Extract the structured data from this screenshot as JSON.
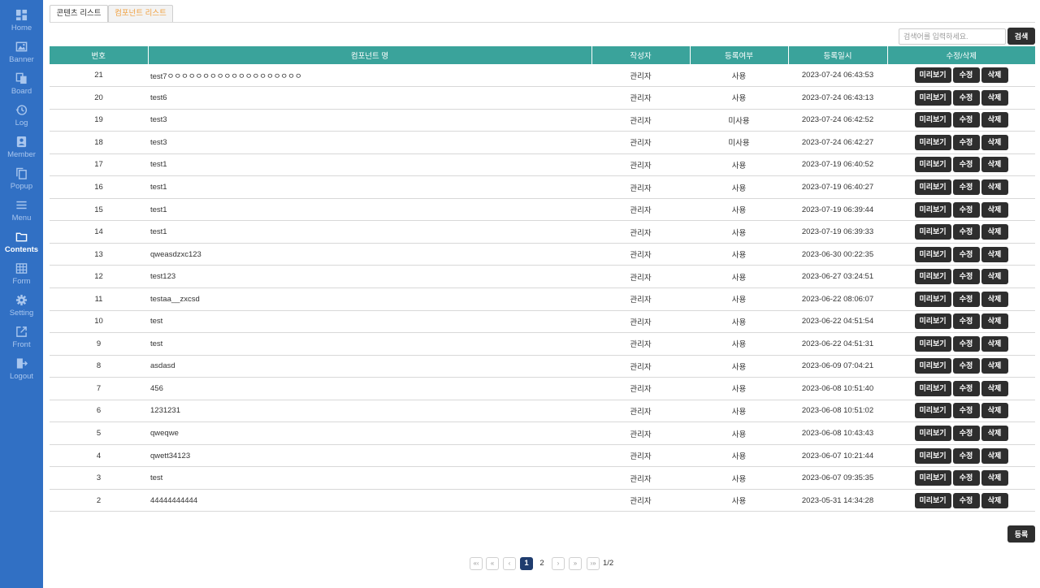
{
  "sidebar": {
    "items": [
      {
        "label": "Home",
        "icon": "dashboard-icon"
      },
      {
        "label": "Banner",
        "icon": "image-icon"
      },
      {
        "label": "Board",
        "icon": "board-icon"
      },
      {
        "label": "Log",
        "icon": "history-icon"
      },
      {
        "label": "Member",
        "icon": "member-badge-icon"
      },
      {
        "label": "Popup",
        "icon": "copy-icon"
      },
      {
        "label": "Menu",
        "icon": "list-icon"
      },
      {
        "label": "Contents",
        "icon": "folder-icon"
      },
      {
        "label": "Form",
        "icon": "table-icon"
      },
      {
        "label": "Setting",
        "icon": "gear-icon"
      },
      {
        "label": "Front",
        "icon": "external-link-icon"
      },
      {
        "label": "Logout",
        "icon": "logout-icon"
      }
    ],
    "active": "Contents"
  },
  "tabs": [
    {
      "label": "콘텐츠 리스트"
    },
    {
      "label": "컴포넌트 리스트"
    }
  ],
  "active_tab": "컴포넌트 리스트",
  "search": {
    "placeholder": "검색어를 입력하세요.",
    "value": "",
    "button": "검색"
  },
  "table": {
    "columns": [
      "번호",
      "컴포넌트 명",
      "작성자",
      "등록여부",
      "등록일시",
      "수정/삭제"
    ],
    "actions": {
      "preview": "미리보기",
      "edit": "수정",
      "delete": "삭제"
    },
    "rows": [
      {
        "no": "21",
        "name": "test7ㅇㅇㅇㅇㅇㅇㅇㅇㅇㅇㅇㅇㅇㅇㅇㅇㅇㅇㅇ",
        "author": "관리자",
        "status": "사용",
        "date": "2023-07-24 06:43:53"
      },
      {
        "no": "20",
        "name": "test6",
        "author": "관리자",
        "status": "사용",
        "date": "2023-07-24 06:43:13"
      },
      {
        "no": "19",
        "name": "test3",
        "author": "관리자",
        "status": "미사용",
        "date": "2023-07-24 06:42:52"
      },
      {
        "no": "18",
        "name": "test3",
        "author": "관리자",
        "status": "미사용",
        "date": "2023-07-24 06:42:27"
      },
      {
        "no": "17",
        "name": "test1",
        "author": "관리자",
        "status": "사용",
        "date": "2023-07-19 06:40:52"
      },
      {
        "no": "16",
        "name": "test1",
        "author": "관리자",
        "status": "사용",
        "date": "2023-07-19 06:40:27"
      },
      {
        "no": "15",
        "name": "test1",
        "author": "관리자",
        "status": "사용",
        "date": "2023-07-19 06:39:44"
      },
      {
        "no": "14",
        "name": "test1",
        "author": "관리자",
        "status": "사용",
        "date": "2023-07-19 06:39:33"
      },
      {
        "no": "13",
        "name": "qweasdzxc123",
        "author": "관리자",
        "status": "사용",
        "date": "2023-06-30 00:22:35"
      },
      {
        "no": "12",
        "name": "test123",
        "author": "관리자",
        "status": "사용",
        "date": "2023-06-27 03:24:51"
      },
      {
        "no": "11",
        "name": "testaa__zxcsd",
        "author": "관리자",
        "status": "사용",
        "date": "2023-06-22 08:06:07"
      },
      {
        "no": "10",
        "name": "test",
        "author": "관리자",
        "status": "사용",
        "date": "2023-06-22 04:51:54"
      },
      {
        "no": "9",
        "name": "test",
        "author": "관리자",
        "status": "사용",
        "date": "2023-06-22 04:51:31"
      },
      {
        "no": "8",
        "name": "asdasd",
        "author": "관리자",
        "status": "사용",
        "date": "2023-06-09 07:04:21"
      },
      {
        "no": "7",
        "name": "456",
        "author": "관리자",
        "status": "사용",
        "date": "2023-06-08 10:51:40"
      },
      {
        "no": "6",
        "name": "1231231",
        "author": "관리자",
        "status": "사용",
        "date": "2023-06-08 10:51:02"
      },
      {
        "no": "5",
        "name": "qweqwe",
        "author": "관리자",
        "status": "사용",
        "date": "2023-06-08 10:43:43"
      },
      {
        "no": "4",
        "name": "qwett34123",
        "author": "관리자",
        "status": "사용",
        "date": "2023-06-07 10:21:44"
      },
      {
        "no": "3",
        "name": "test",
        "author": "관리자",
        "status": "사용",
        "date": "2023-06-07 09:35:35"
      },
      {
        "no": "2",
        "name": "44444444444",
        "author": "관리자",
        "status": "사용",
        "date": "2023-05-31 14:34:28"
      }
    ]
  },
  "register_button": "등록",
  "pagination": {
    "first": "«‹",
    "prev_block": "«",
    "prev": "‹",
    "pages": [
      "1",
      "2"
    ],
    "current": "1",
    "next": "›",
    "next_block": "»",
    "last": "›»",
    "total": "1/2"
  },
  "colors": {
    "sidebar": "#3170c4",
    "header": "#3aa39b",
    "button": "#2e2e2e",
    "active_tab_text": "#f0a040",
    "current_page": "#1f3c6e"
  }
}
